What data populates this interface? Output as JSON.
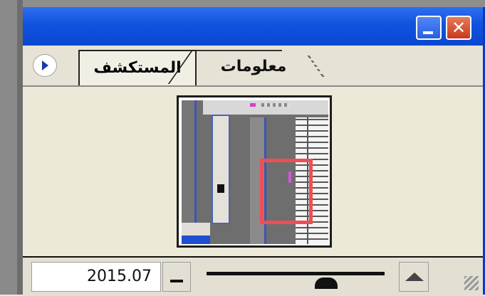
{
  "window": {
    "tabs": [
      {
        "label": "المستكشف",
        "active": true
      },
      {
        "label": "معلومات",
        "active": false
      }
    ]
  },
  "zoom": {
    "value": "2015.07",
    "slider_fraction": 0.72
  },
  "colors": {
    "titlebar": "#0b46d2",
    "view_box": "#ef4e54",
    "close_button": "#d7452f"
  },
  "icons": {
    "close": "close-icon",
    "minimize": "minimize-icon",
    "menu": "panel-menu-icon",
    "zoom_out": "zoom-out-icon",
    "zoom_in": "zoom-in-icon"
  }
}
